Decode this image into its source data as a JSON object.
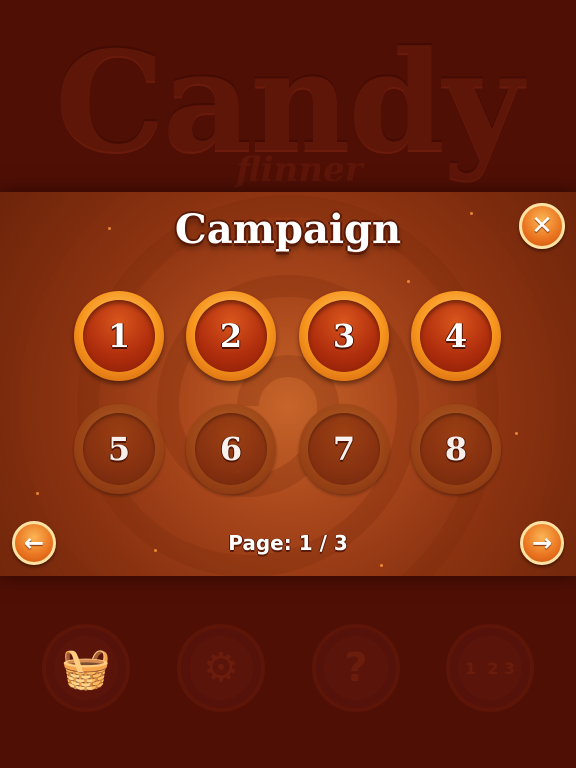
{
  "background": {
    "logo_title": "Candy",
    "logo_subtitle": "flinner"
  },
  "bottom_menu": [
    {
      "name": "shop-basket-icon",
      "glyph": "🧺"
    },
    {
      "name": "settings-gear-icon",
      "glyph": "⚙"
    },
    {
      "name": "help-question-icon",
      "glyph": "?"
    },
    {
      "name": "leaderboard-podium-icon",
      "glyph": "1  2 3"
    }
  ],
  "dialog": {
    "title": "Campaign",
    "close_glyph": "✕",
    "levels": [
      {
        "label": "1",
        "locked": false
      },
      {
        "label": "2",
        "locked": false
      },
      {
        "label": "3",
        "locked": false
      },
      {
        "label": "4",
        "locked": false
      },
      {
        "label": "5",
        "locked": true
      },
      {
        "label": "6",
        "locked": true
      },
      {
        "label": "7",
        "locked": true
      },
      {
        "label": "8",
        "locked": true
      }
    ],
    "page_text": "Page: 1 / 3",
    "prev_glyph": "←",
    "next_glyph": "→"
  },
  "colors": {
    "background": "#4f0f05",
    "accent_orange": "#f7951d",
    "panel_center": "#c6642a"
  }
}
